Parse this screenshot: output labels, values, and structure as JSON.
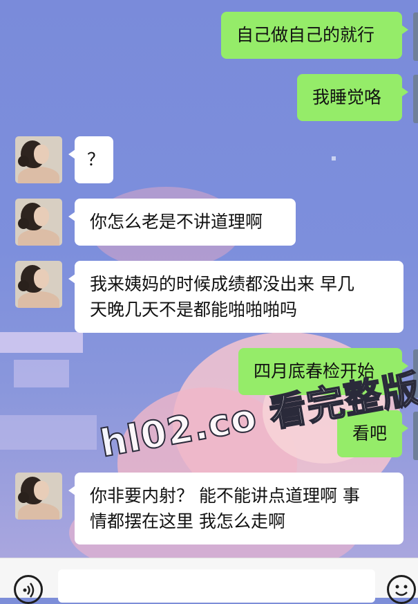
{
  "messages": [
    {
      "side": "out",
      "text": "自己做自己的就行"
    },
    {
      "side": "out",
      "text": "我睡觉咯"
    },
    {
      "side": "in",
      "text": "？"
    },
    {
      "side": "in",
      "text": "你怎么老是不讲道理啊"
    },
    {
      "side": "in",
      "line1": "我来姨妈的时候成绩都没出来 早几",
      "line2": "天晚几天不是都能啪啪啪吗"
    },
    {
      "side": "out",
      "text": "四月底春检开始"
    },
    {
      "side": "out",
      "text": "看吧"
    },
    {
      "side": "in",
      "line1": "你非要内射？ 能不能讲点道理啊 事",
      "line2": "情都摆在这里 我怎么走啊"
    }
  ],
  "watermark": "hl02.co 看完整版",
  "input_bar": {
    "voice_icon": "voice-icon",
    "emoji_icon": "emoji-icon",
    "input_value": ""
  },
  "colors": {
    "outgoing_bubble": "#95ec69",
    "incoming_bubble": "#ffffff",
    "background": "#7d8ed8"
  }
}
